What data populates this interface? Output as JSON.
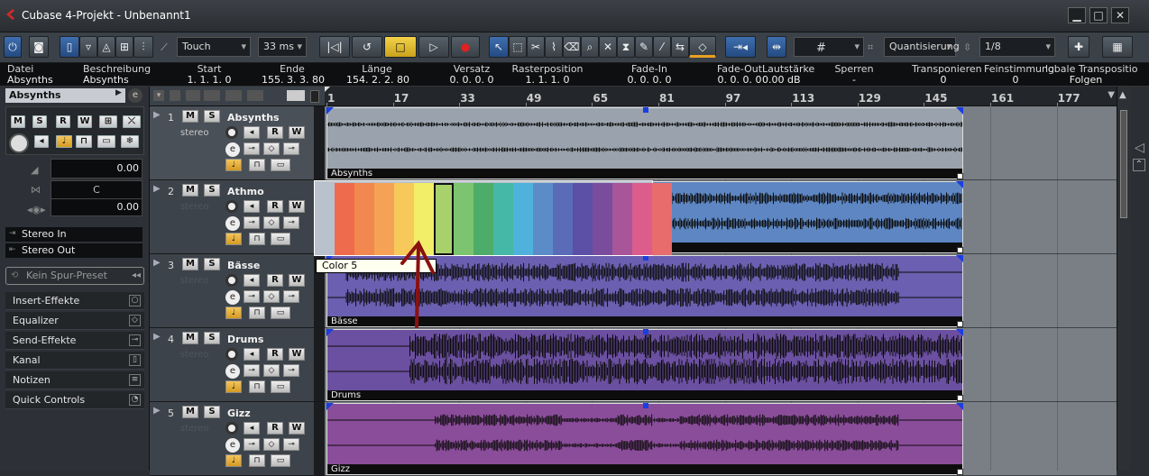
{
  "window": {
    "title": "Cubase 4-Projekt - Unbenannt1",
    "minimize": "▁",
    "maximize": "□",
    "close": "✕"
  },
  "toolbar": {
    "automation_mode": "Touch",
    "latency": "33 ms",
    "grid_type": "Quantisierung",
    "quantize_value": "1/8",
    "snap_symbol": "#"
  },
  "infoline": [
    {
      "header": "Datei",
      "value": "Absynths"
    },
    {
      "header": "Beschreibung",
      "value": "Absynths"
    },
    {
      "header": "Start",
      "value": "1. 1. 1.   0"
    },
    {
      "header": "Ende",
      "value": "155. 3. 3. 80"
    },
    {
      "header": "Länge",
      "value": "154. 2. 2. 80"
    },
    {
      "header": "Versatz",
      "value": "0. 0. 0.   0"
    },
    {
      "header": "Rasterposition",
      "value": "1. 1. 1.   0"
    },
    {
      "header": "Fade-In",
      "value": "0. 0. 0.   0"
    },
    {
      "header": "Fade-Out",
      "value": "0. 0. 0.   0"
    },
    {
      "header": "Lautstärke",
      "value": "0.00 dB"
    },
    {
      "header": "Sperren",
      "value": "-"
    },
    {
      "header": "Transponieren",
      "value": "0"
    },
    {
      "header": "Feinstimmung",
      "value": "0"
    },
    {
      "header": "lobale Transpositio",
      "value": "Folgen"
    }
  ],
  "inspector": {
    "track_name": "Absynths",
    "volume": "0.00",
    "pan": "C",
    "delay": "0.00",
    "input": "Stereo In",
    "output": "Stereo Out",
    "preset_placeholder": "Kein Spur-Preset",
    "sections": [
      "Insert-Effekte",
      "Equalizer",
      "Send-Effekte",
      "Kanal",
      "Notizen",
      "Quick Controls"
    ]
  },
  "buttons": {
    "mute": "M",
    "solo": "S",
    "read": "R",
    "write": "W"
  },
  "ruler": [
    "1",
    "17",
    "33",
    "49",
    "65",
    "81",
    "97",
    "113",
    "129",
    "145",
    "161",
    "177"
  ],
  "tracks": [
    {
      "num": "1",
      "name": "Absynths",
      "sub": "stereo",
      "event": "Absynths",
      "color": "#9aa3ad"
    },
    {
      "num": "2",
      "name": "Athmo",
      "sub": "stereo",
      "event": "Athmo",
      "color": "#5d86c2"
    },
    {
      "num": "3",
      "name": "Bässe",
      "sub": "stereo",
      "event": "Bässe",
      "color": "#6a5fb0"
    },
    {
      "num": "4",
      "name": "Drums",
      "sub": "stereo",
      "event": "Drums",
      "color": "#6b4fa0"
    },
    {
      "num": "5",
      "name": "Gizz",
      "sub": "stereo",
      "event": "Gizz",
      "color": "#8a4d9a"
    }
  ],
  "color_picker": {
    "swatches": [
      "#ef6b4e",
      "#f2874f",
      "#f5a256",
      "#f6c95a",
      "#f2ee67",
      "#a8d16b",
      "#7cc46f",
      "#4eac6a",
      "#46b8a8",
      "#4fb2dc",
      "#5c8cc8",
      "#5a6cb8",
      "#5b4fa6",
      "#7a4c9e",
      "#a8559a",
      "#dc5d8c",
      "#e86c6c"
    ],
    "selected_index": 5,
    "tooltip": "Color 5"
  }
}
